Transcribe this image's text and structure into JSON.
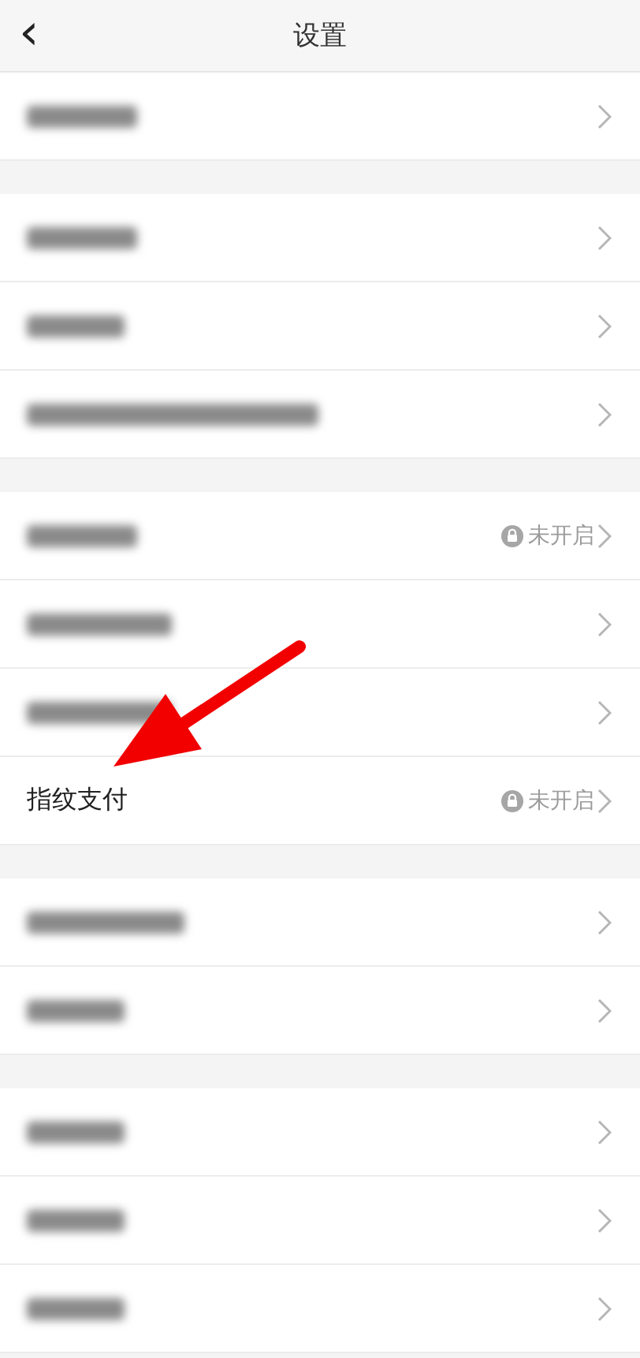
{
  "header": {
    "back_icon": "‹",
    "title": "设置"
  },
  "sections": [
    {
      "rows": [
        {
          "kind": "blurred"
        }
      ]
    },
    {
      "rows": [
        {
          "kind": "blurred"
        },
        {
          "kind": "blurred"
        },
        {
          "kind": "blurred"
        }
      ]
    },
    {
      "rows": [
        {
          "kind": "blurred",
          "status": "未开启"
        },
        {
          "kind": "blurred"
        },
        {
          "kind": "blurred"
        },
        {
          "kind": "text",
          "label": "指纹支付",
          "status": "未开启"
        }
      ]
    },
    {
      "rows": [
        {
          "kind": "blurred"
        },
        {
          "kind": "blurred"
        }
      ]
    },
    {
      "rows": [
        {
          "kind": "blurred"
        },
        {
          "kind": "blurred"
        },
        {
          "kind": "blurred"
        }
      ]
    }
  ],
  "annotation": {
    "kind": "arrow"
  }
}
